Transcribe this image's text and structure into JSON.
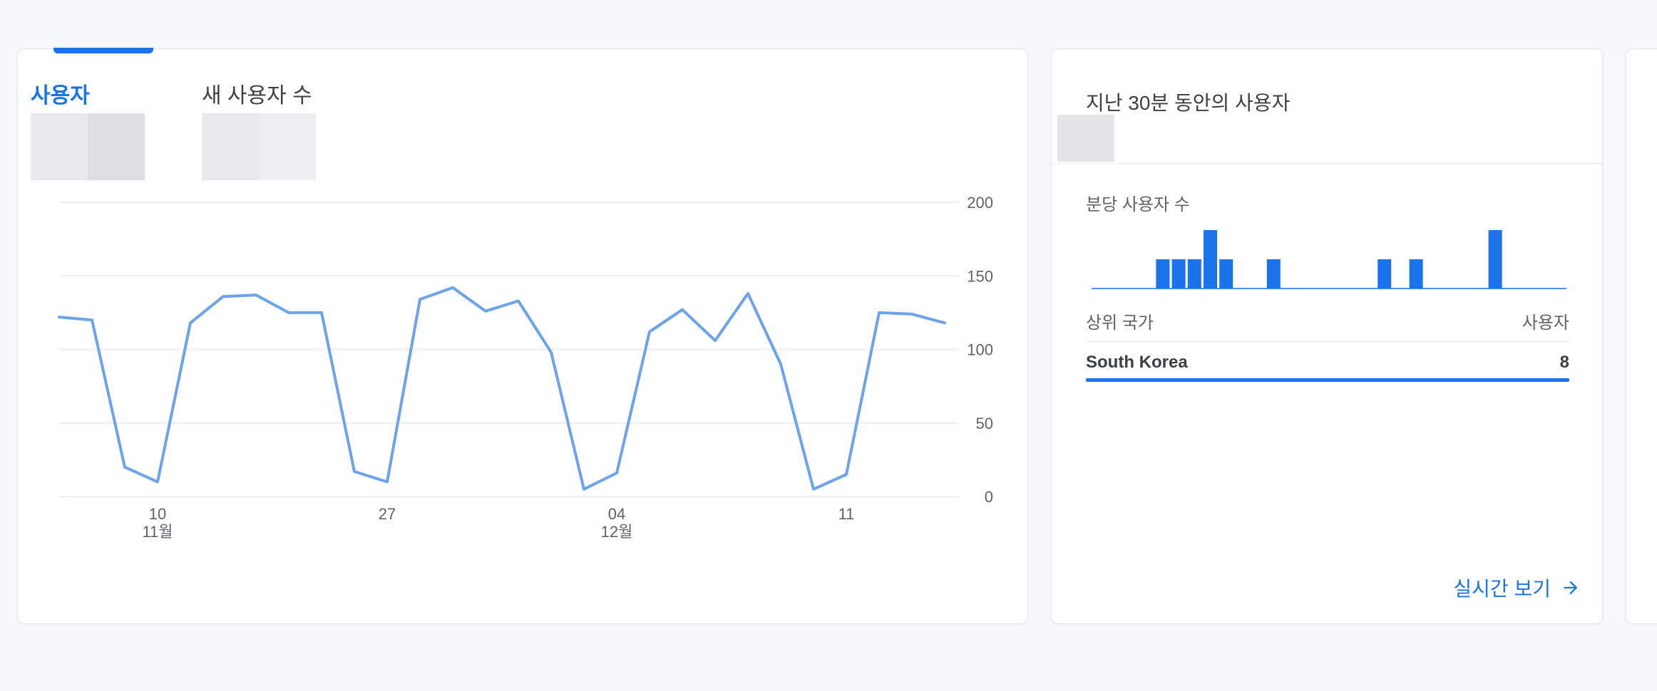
{
  "main_card": {
    "tabs": [
      {
        "label": "사용자"
      },
      {
        "label": "새 사용자 수"
      }
    ],
    "y_axis_ticks": [
      "200",
      "150",
      "100",
      "50",
      "0"
    ],
    "x_axis_ticks": [
      {
        "day": "10",
        "month": "11월"
      },
      {
        "day": "27",
        "month": ""
      },
      {
        "day": "04",
        "month": "12월"
      },
      {
        "day": "11",
        "month": ""
      }
    ],
    "colors": {
      "line": "#6ca3ec",
      "accent": "#1a73e8"
    }
  },
  "chart_data": {
    "type": "line",
    "series": [
      {
        "values": [
          122,
          120,
          20,
          10,
          118,
          136,
          137,
          125,
          125,
          17,
          10,
          134,
          142,
          126,
          133,
          98,
          5,
          16,
          112,
          127,
          106,
          138,
          90,
          5,
          15,
          125,
          124,
          118
        ]
      }
    ],
    "x_ticks": [
      "10",
      "27",
      "04",
      "11"
    ],
    "x_tick_sublabels": [
      "11월",
      "",
      "12월",
      ""
    ],
    "ylim": [
      0,
      200
    ],
    "y_ticks": [
      0,
      50,
      100,
      150,
      200
    ],
    "grid": true
  },
  "realtime_card": {
    "title": "지난 30분 동안의 사용자",
    "subtitle": "분당 사용자 수",
    "bars": [
      0,
      0,
      0,
      0,
      1,
      1,
      1,
      2,
      1,
      0,
      0,
      1,
      0,
      0,
      0,
      0,
      0,
      0,
      1,
      0,
      1,
      0,
      0,
      0,
      0,
      2,
      0,
      0,
      0,
      0
    ],
    "table": {
      "col_country": "상위 국가",
      "col_users": "사용자",
      "rows": [
        {
          "country": "South Korea",
          "users": "8"
        }
      ]
    },
    "link_label": "실시간 보기",
    "link_icon": "arrow-right-icon"
  }
}
